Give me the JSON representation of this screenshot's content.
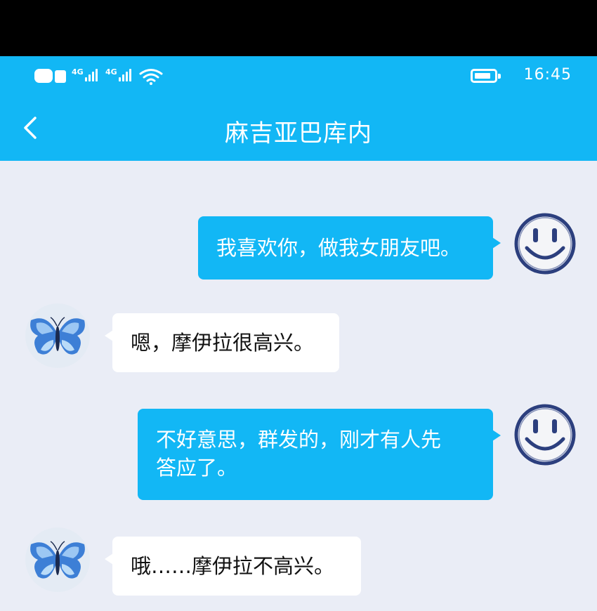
{
  "status_bar": {
    "network_1": "4G",
    "network_2": "4G",
    "time": "16:45",
    "icons": [
      "hd-icon",
      "signal-icon",
      "signal-icon",
      "wifi-icon",
      "battery-icon"
    ]
  },
  "header": {
    "title": "麻吉亚巴库内",
    "back_icon": "chevron-left-icon"
  },
  "messages": [
    {
      "sender": "me",
      "text": "我喜欢你，做我女朋友吧。",
      "avatar_icon": "smiley-face-icon"
    },
    {
      "sender": "other",
      "text": "嗯，摩伊拉很高兴。",
      "avatar_icon": "butterfly-icon"
    },
    {
      "sender": "me",
      "text_lines": [
        "不好意思，群发的，刚才有人先",
        "答应了。"
      ],
      "avatar_icon": "smiley-face-icon"
    },
    {
      "sender": "other",
      "text": "哦……摩伊拉不高兴。",
      "avatar_icon": "butterfly-icon"
    }
  ],
  "colors": {
    "accent": "#12b7f5",
    "chat_background": "#eaedf6",
    "incoming_bubble": "#ffffff",
    "outgoing_bubble": "#12b7f5"
  }
}
